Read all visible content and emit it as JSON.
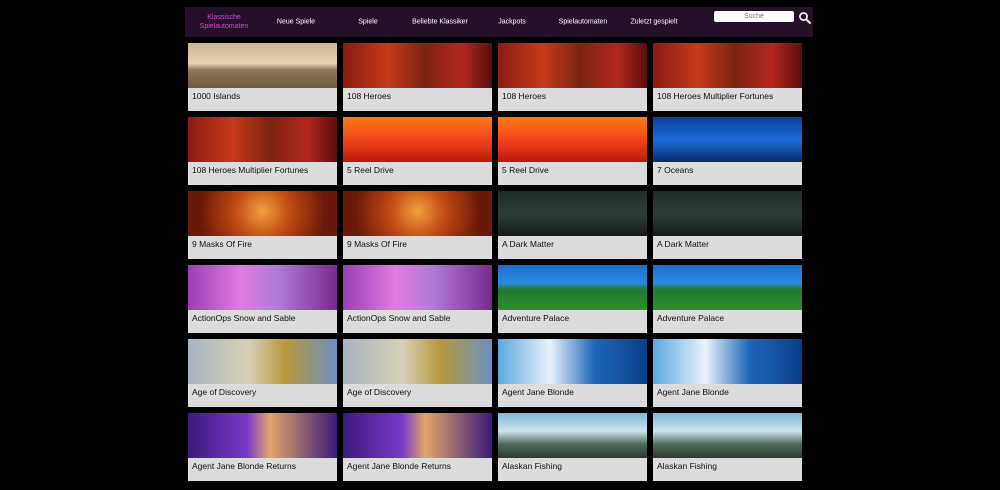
{
  "nav": {
    "items": [
      {
        "label": "Klassische Spielautomaten",
        "active": true
      },
      {
        "label": "Neue Spiele"
      },
      {
        "label": "Spiele"
      },
      {
        "label": "Beliebte Klassiker"
      },
      {
        "label": "Jackpots"
      },
      {
        "label": "Spielautomaten"
      },
      {
        "label": "Zuletzt gespielt"
      }
    ],
    "search_placeholder": "Suche",
    "accent_color": "#d34ad3",
    "bar_color": "#241028"
  },
  "games": [
    {
      "title": "1000 Islands",
      "art": "t-islands"
    },
    {
      "title": "108 Heroes",
      "art": "t-heroes"
    },
    {
      "title": "108 Heroes",
      "art": "t-heroes"
    },
    {
      "title": "108 Heroes Multiplier Fortunes",
      "art": "t-heroes"
    },
    {
      "title": "108 Heroes Multiplier Fortunes",
      "art": "t-heroes"
    },
    {
      "title": "5 Reel Drive",
      "art": "t-reel"
    },
    {
      "title": "5 Reel Drive",
      "art": "t-reel"
    },
    {
      "title": "7 Oceans",
      "art": "t-oceans"
    },
    {
      "title": "9 Masks Of Fire",
      "art": "t-masks"
    },
    {
      "title": "9 Masks Of Fire",
      "art": "t-masks"
    },
    {
      "title": "A Dark Matter",
      "art": "t-matter"
    },
    {
      "title": "A Dark Matter",
      "art": "t-matter"
    },
    {
      "title": "ActionOps Snow and Sable",
      "art": "t-snow"
    },
    {
      "title": "ActionOps Snow and Sable",
      "art": "t-snow"
    },
    {
      "title": "Adventure Palace",
      "art": "t-palace"
    },
    {
      "title": "Adventure Palace",
      "art": "t-palace"
    },
    {
      "title": "Age of Discovery",
      "art": "t-discovery"
    },
    {
      "title": "Age of Discovery",
      "art": "t-discovery"
    },
    {
      "title": "Agent Jane Blonde",
      "art": "t-jane"
    },
    {
      "title": "Agent Jane Blonde",
      "art": "t-jane"
    },
    {
      "title": "Agent Jane Blonde Returns",
      "art": "t-returns"
    },
    {
      "title": "Agent Jane Blonde Returns",
      "art": "t-returns"
    },
    {
      "title": "Alaskan Fishing",
      "art": "t-alaskan"
    },
    {
      "title": "Alaskan Fishing",
      "art": "t-alaskan"
    }
  ]
}
